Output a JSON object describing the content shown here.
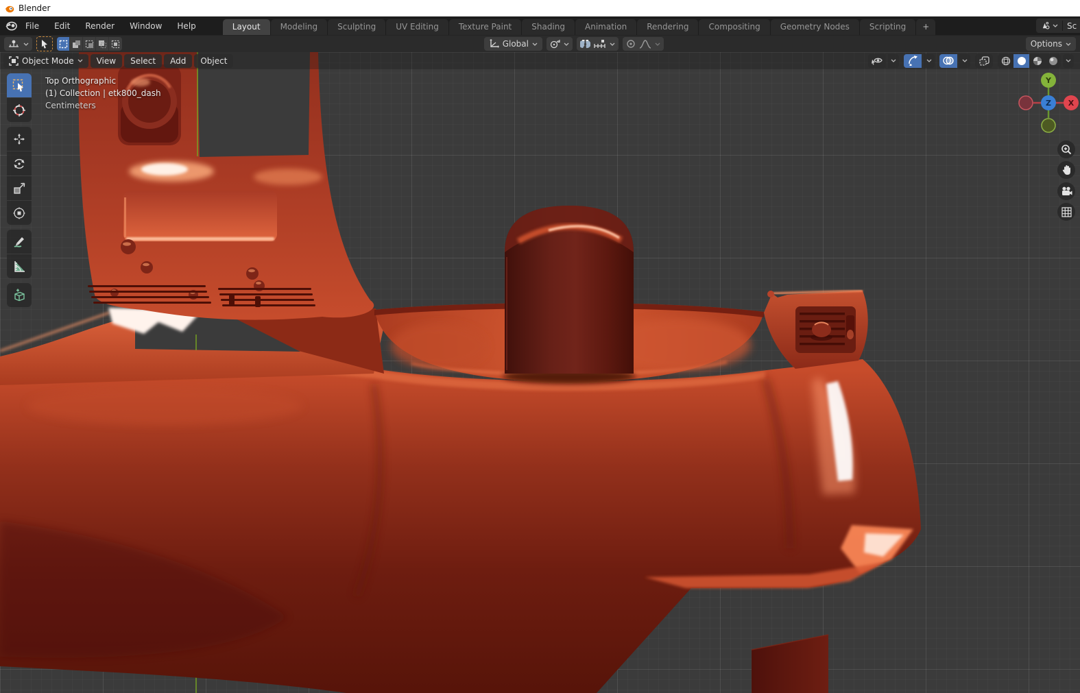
{
  "window": {
    "title": "Blender"
  },
  "topbar": {
    "menus": [
      "File",
      "Edit",
      "Render",
      "Window",
      "Help"
    ],
    "tabs": [
      "Layout",
      "Modeling",
      "Sculpting",
      "UV Editing",
      "Texture Paint",
      "Shading",
      "Animation",
      "Rendering",
      "Compositing",
      "Geometry Nodes",
      "Scripting"
    ],
    "active_tab": "Layout",
    "add_tab_label": "+",
    "scene_selector_truncated": "Sc"
  },
  "tool_settings": {
    "transform_orientation": "Global",
    "options_label": "Options",
    "select_modes": [
      "set",
      "extend",
      "subtract",
      "invert",
      "intersect"
    ],
    "active_select_mode": "set"
  },
  "viewport": {
    "header": {
      "mode": "Object Mode",
      "menus": [
        "View",
        "Select",
        "Add",
        "Object"
      ],
      "toggles": [
        "object-type-visibility",
        "gizmos",
        "overlays",
        "toggle-xray"
      ],
      "shading_modes": [
        "wireframe",
        "solid",
        "material-preview",
        "rendered"
      ],
      "active_shading": "solid"
    },
    "overlay": {
      "view_name": "Top Orthographic",
      "context": "(1) Collection | etk800_dash",
      "units": "Centimeters"
    },
    "gizmo": {
      "x_label": "X",
      "y_label": "Y",
      "z_label": "Z"
    }
  },
  "toolbar_tools": [
    "select-box",
    "cursor",
    "move",
    "rotate",
    "scale",
    "transform",
    "annotate",
    "measure",
    "add-cube"
  ],
  "colors": {
    "accent_blue": "#4772b3",
    "axis_x": "#e0454e",
    "axis_y": "#84b33a",
    "axis_z": "#3a7fd5",
    "viewport_bg": "#3b3b3b",
    "model_red": "#9c2f1b",
    "axis_line_green": "#74a023"
  }
}
